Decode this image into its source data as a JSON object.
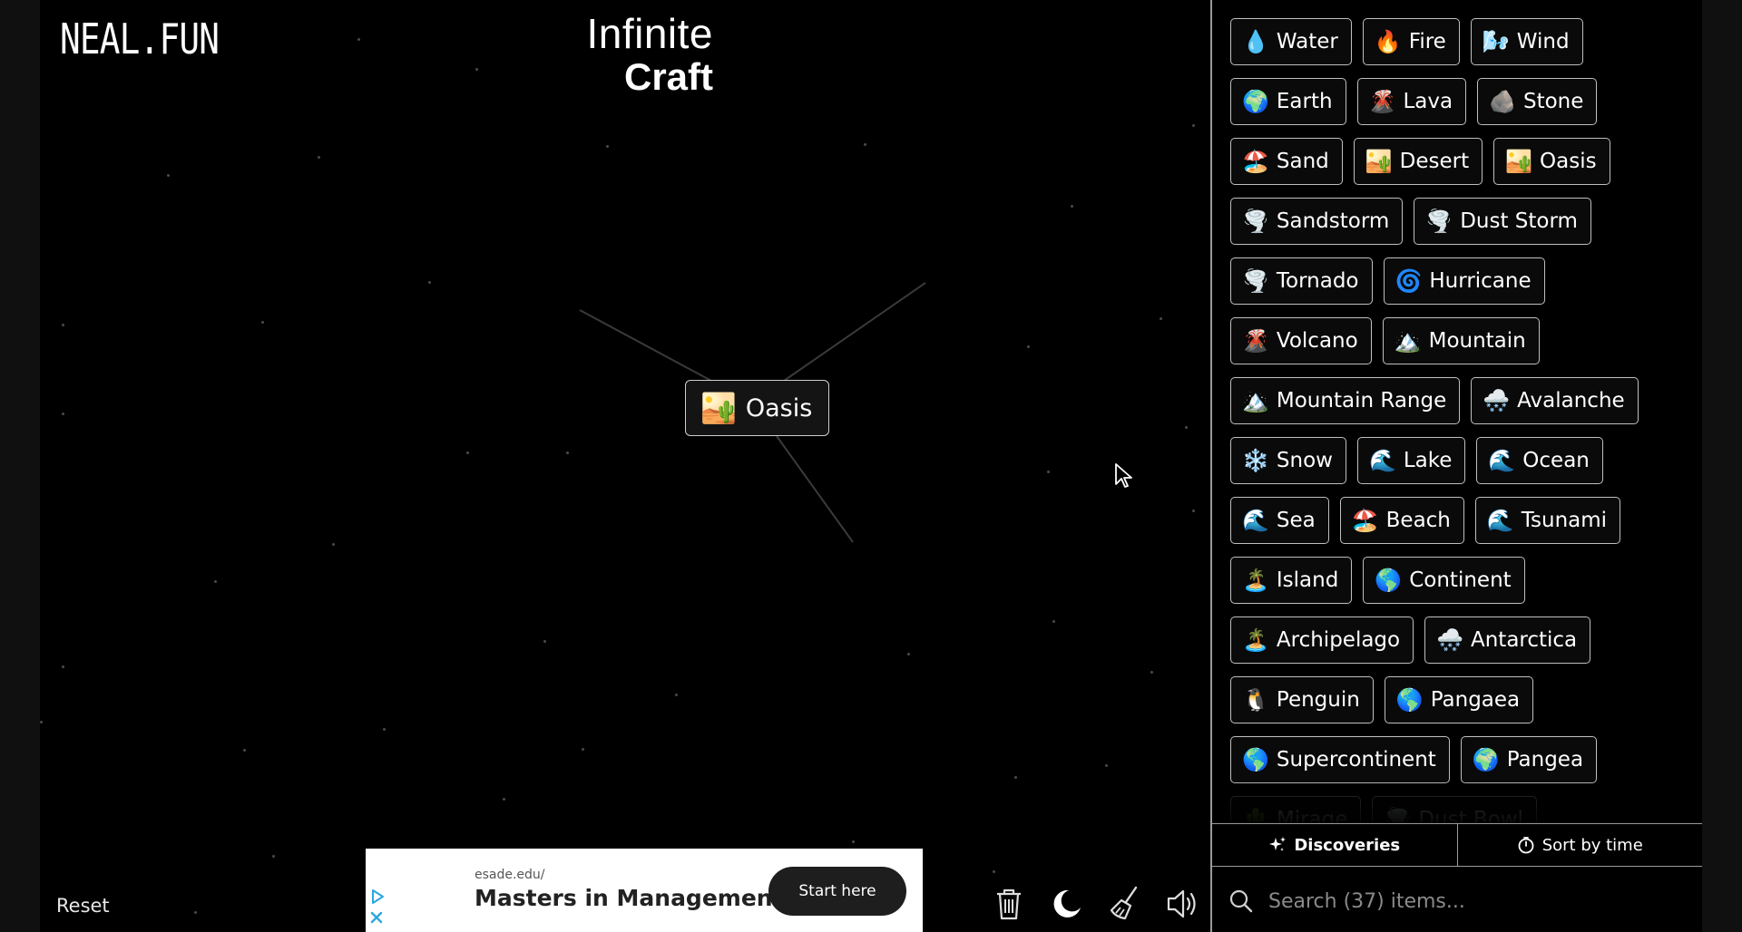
{
  "header": {
    "logo": "NEAL.FUN",
    "title_line1": "Infinite",
    "title_line2": "Craft"
  },
  "canvas": {
    "item": {
      "emoji": "🏜️",
      "label": "Oasis"
    },
    "reset_label": "Reset"
  },
  "ad": {
    "url": "esade.edu/",
    "headline": "Masters in Management",
    "cta": "Start here",
    "choices_icon": "adchoices-icon",
    "close_icon": "close-icon"
  },
  "toolbar": {
    "icons": [
      "trash-icon",
      "moon-icon",
      "broom-icon",
      "speaker-icon"
    ]
  },
  "sidebar": {
    "items": [
      {
        "emoji": "💧",
        "label": "Water"
      },
      {
        "emoji": "🔥",
        "label": "Fire"
      },
      {
        "emoji": "🌬️",
        "label": "Wind"
      },
      {
        "emoji": "🌍",
        "label": "Earth"
      },
      {
        "emoji": "🌋",
        "label": "Lava"
      },
      {
        "emoji": "🪨",
        "label": "Stone"
      },
      {
        "emoji": "🏖️",
        "label": "Sand"
      },
      {
        "emoji": "🏜️",
        "label": "Desert"
      },
      {
        "emoji": "🏜️",
        "label": "Oasis"
      },
      {
        "emoji": "🌪️",
        "label": "Sandstorm"
      },
      {
        "emoji": "🌪️",
        "label": "Dust Storm"
      },
      {
        "emoji": "🌪️",
        "label": "Tornado"
      },
      {
        "emoji": "🌀",
        "label": "Hurricane"
      },
      {
        "emoji": "🌋",
        "label": "Volcano"
      },
      {
        "emoji": "🏔️",
        "label": "Mountain"
      },
      {
        "emoji": "🏔️",
        "label": "Mountain Range"
      },
      {
        "emoji": "🌨️",
        "label": "Avalanche"
      },
      {
        "emoji": "❄️",
        "label": "Snow"
      },
      {
        "emoji": "🌊",
        "label": "Lake"
      },
      {
        "emoji": "🌊",
        "label": "Ocean"
      },
      {
        "emoji": "🌊",
        "label": "Sea"
      },
      {
        "emoji": "🏖️",
        "label": "Beach"
      },
      {
        "emoji": "🌊",
        "label": "Tsunami"
      },
      {
        "emoji": "🏝️",
        "label": "Island"
      },
      {
        "emoji": "🌎",
        "label": "Continent"
      },
      {
        "emoji": "🏝️",
        "label": "Archipelago"
      },
      {
        "emoji": "🌨️",
        "label": "Antarctica"
      },
      {
        "emoji": "🐧",
        "label": "Penguin"
      },
      {
        "emoji": "🌎",
        "label": "Pangaea"
      },
      {
        "emoji": "🌎",
        "label": "Supercontinent"
      },
      {
        "emoji": "🌍",
        "label": "Pangea"
      },
      {
        "emoji": "🌵",
        "label": "Mirage",
        "faded": true
      },
      {
        "emoji": "🌪️",
        "label": "Dust Bowl",
        "faded": true
      }
    ],
    "discoveries_label": "Discoveries",
    "sort_label": "Sort by time",
    "search_placeholder": "Search (37) items..."
  }
}
